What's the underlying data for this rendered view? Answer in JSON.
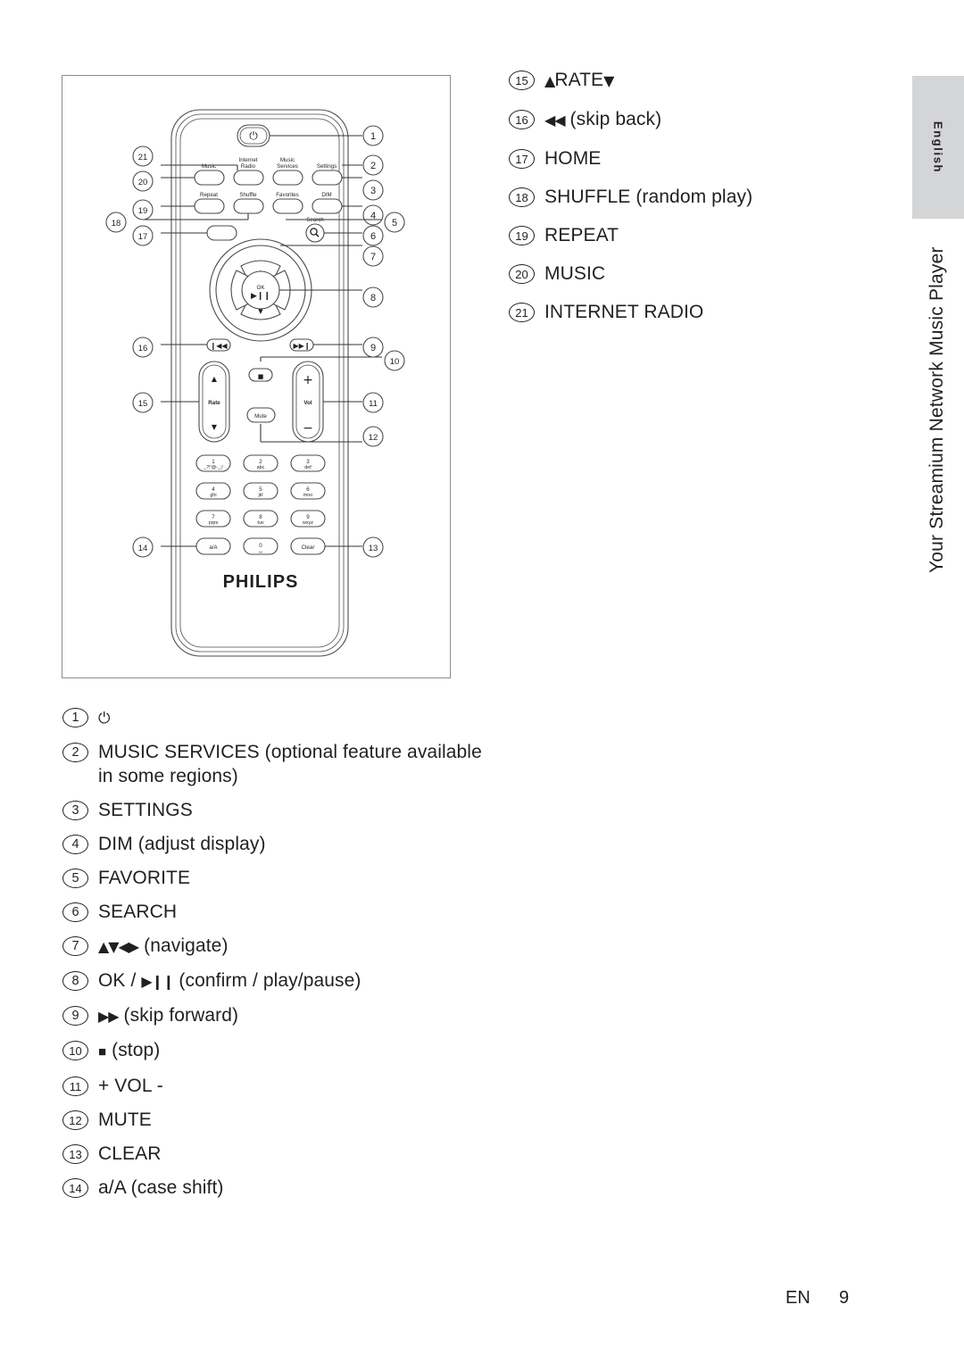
{
  "sidebar": {
    "language_tab": "English",
    "section_title": "Your Streamium Network Music Player"
  },
  "figure": {
    "brand": "PHILIPS",
    "remote_buttons": {
      "power": "⏻",
      "music": "Music",
      "internet_radio_line1": "Internet",
      "internet_radio_line2": "Radio",
      "music_services_line1": "Music",
      "music_services_line2": "Services",
      "settings": "Settings",
      "repeat": "Repeat",
      "shuffle": "Shuffle",
      "favorites": "Favorites",
      "dim": "DIM",
      "search": "Search",
      "ok": "OK",
      "ok_sub": "▶❙❙",
      "rate": "Rate",
      "vol": "Vol",
      "vol_plus": "+",
      "vol_minus": "−",
      "mute": "Mute",
      "keypad": [
        {
          "num": "1",
          "sub": "_?!'@-_:/"
        },
        {
          "num": "2",
          "sub": "abc"
        },
        {
          "num": "3",
          "sub": "def"
        },
        {
          "num": "4",
          "sub": "ghi"
        },
        {
          "num": "5",
          "sub": "jkl"
        },
        {
          "num": "6",
          "sub": "mno"
        },
        {
          "num": "7",
          "sub": "pqrs"
        },
        {
          "num": "8",
          "sub": "tuv"
        },
        {
          "num": "9",
          "sub": "wxyz"
        },
        {
          "num": "a/A",
          "sub": ""
        },
        {
          "num": "0",
          "sub": "␣"
        },
        {
          "num": "Clear",
          "sub": ""
        }
      ]
    },
    "callouts": [
      "1",
      "2",
      "3",
      "4",
      "5",
      "6",
      "7",
      "8",
      "9",
      "10",
      "11",
      "12",
      "13",
      "14",
      "15",
      "16",
      "17",
      "18",
      "19",
      "20",
      "21"
    ]
  },
  "legend_right": [
    {
      "num": "15",
      "text": "▲RATE▼"
    },
    {
      "num": "16",
      "text": "◀◀ (skip back)"
    },
    {
      "num": "17",
      "text": "HOME"
    },
    {
      "num": "18",
      "text": "SHUFFLE (random play)"
    },
    {
      "num": "19",
      "text": "REPEAT"
    },
    {
      "num": "20",
      "text": "MUSIC"
    },
    {
      "num": "21",
      "text": "INTERNET RADIO"
    }
  ],
  "legend_bottom": [
    {
      "num": "1",
      "text": "⏻"
    },
    {
      "num": "2",
      "text": "MUSIC SERVICES (optional feature available in some regions)"
    },
    {
      "num": "3",
      "text": "SETTINGS"
    },
    {
      "num": "4",
      "text": "DIM (adjust display)"
    },
    {
      "num": "5",
      "text": "FAVORITE"
    },
    {
      "num": "6",
      "text": "SEARCH"
    },
    {
      "num": "7",
      "text": "▲▼◀▶ (navigate)"
    },
    {
      "num": "8",
      "text": "OK / ▶❙❙ (confirm / play/pause)"
    },
    {
      "num": "9",
      "text": "▶▶ (skip forward)"
    },
    {
      "num": "10",
      "text": "■ (stop)"
    },
    {
      "num": "11",
      "text": "+ VOL -"
    },
    {
      "num": "12",
      "text": "MUTE"
    },
    {
      "num": "13",
      "text": "CLEAR"
    },
    {
      "num": "14",
      "text": "a/A (case shift)"
    }
  ],
  "footer": {
    "lang_code": "EN",
    "page_number": "9"
  },
  "colors": {
    "ink": "#231f20",
    "tab_gray": "#d4d5d7",
    "frame_line": "#8d8d8d"
  }
}
